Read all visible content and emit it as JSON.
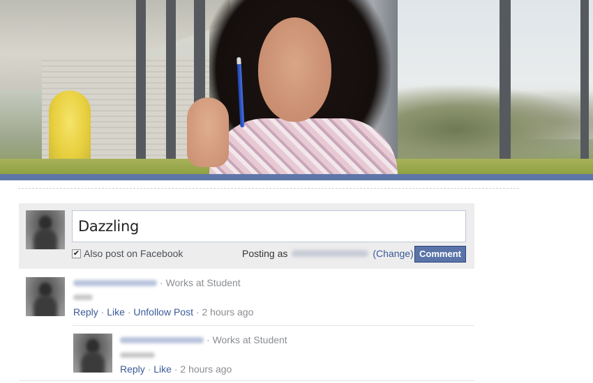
{
  "composer": {
    "input_value": "Dazzling",
    "also_post_label": "Also post on Facebook",
    "also_post_checked": true,
    "posting_as_prefix": "Posting as",
    "change_link": "(Change)",
    "comment_button": "Comment"
  },
  "comments": [
    {
      "affiliation": "Works at Student",
      "actions": {
        "reply": "Reply",
        "like": "Like",
        "unfollow": "Unfollow Post"
      },
      "time": "2 hours ago"
    },
    {
      "affiliation": "Works at Student",
      "actions": {
        "reply": "Reply",
        "like": "Like"
      },
      "time": "2 hours ago"
    }
  ],
  "separators": {
    "dot": "·"
  },
  "colors": {
    "band": "#5f77a8",
    "link": "#3b5998",
    "button": "#5b74a8"
  },
  "icons": {
    "checkbox": "checkmark-icon"
  }
}
